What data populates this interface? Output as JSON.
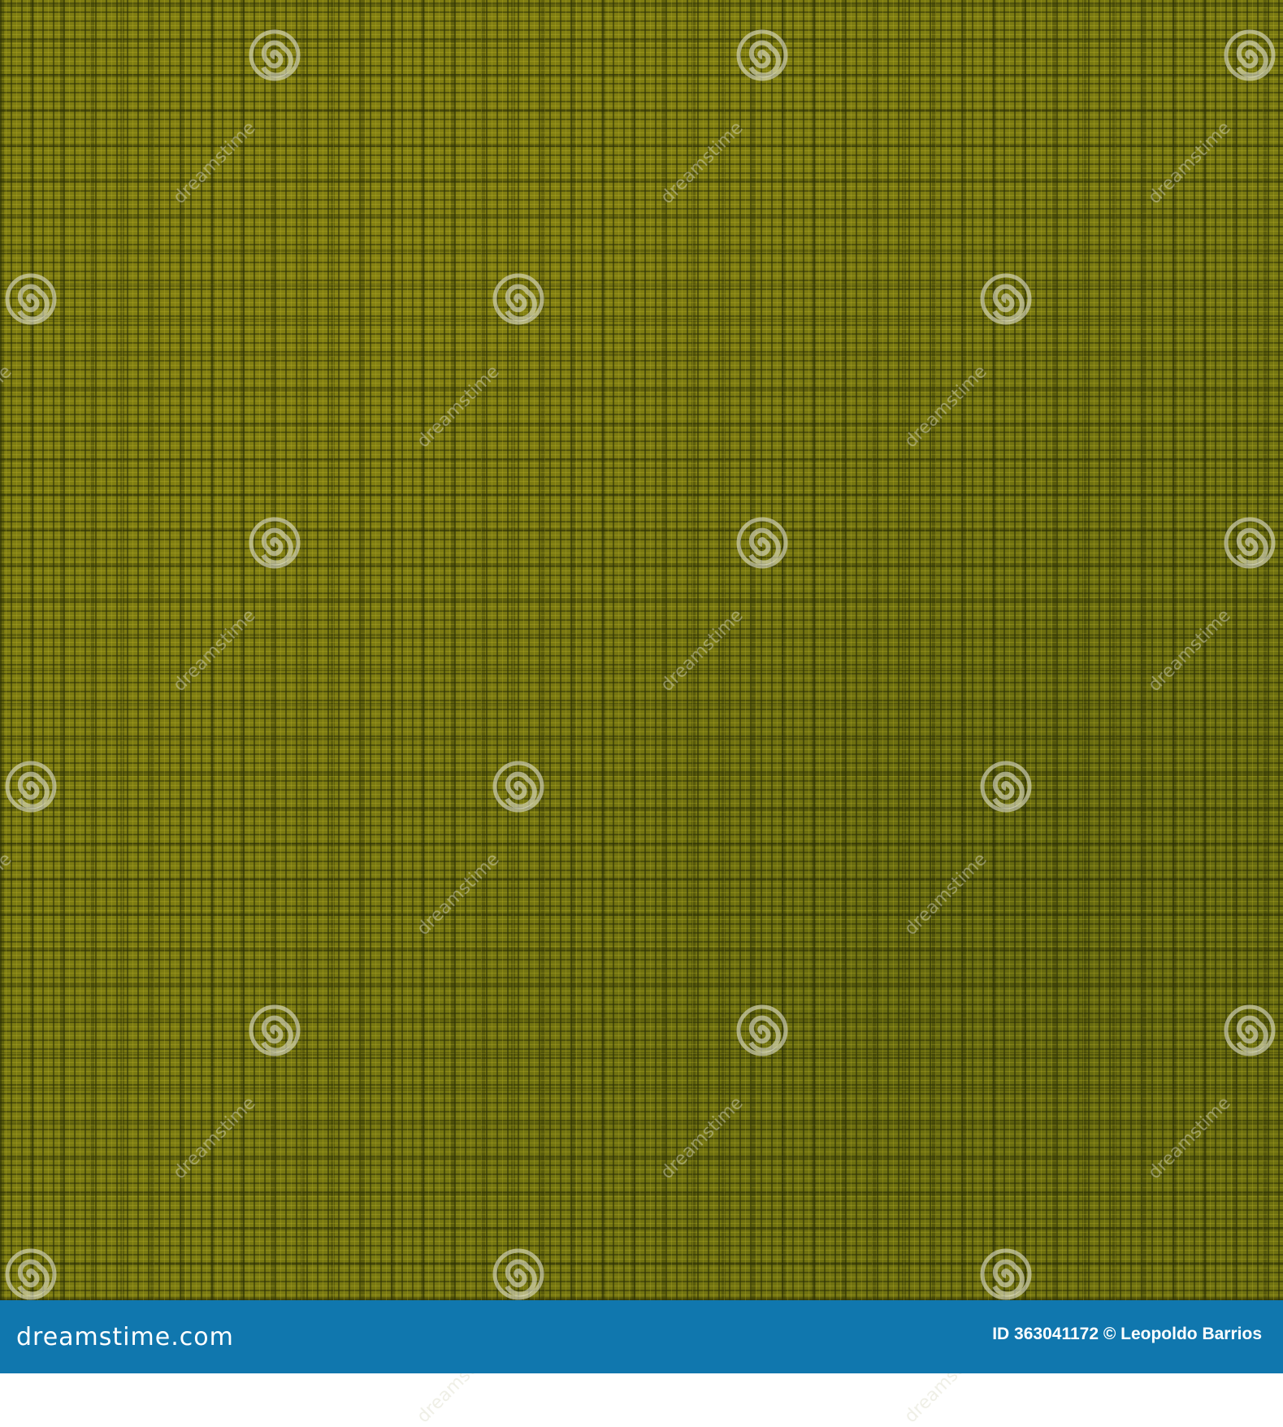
{
  "watermark": {
    "text": "dreamstime"
  },
  "footer": {
    "logo": "dreamstime.com",
    "credit": "ID 363041172 © Leopoldo Barrios",
    "background": "#1077ae"
  },
  "image": {
    "base_color": "#7a7a12"
  }
}
